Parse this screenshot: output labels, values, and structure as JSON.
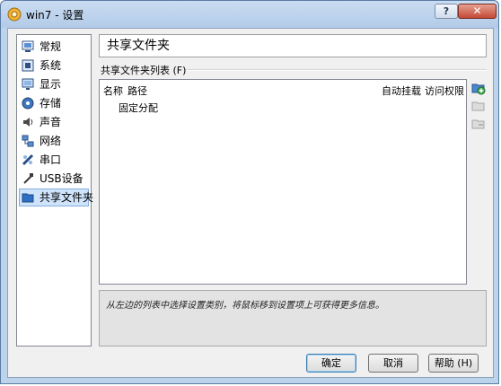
{
  "window": {
    "title": "win7 - 设置",
    "help_glyph": "?",
    "close_glyph": "✕"
  },
  "sidebar": {
    "items": [
      {
        "label": "常规",
        "icon": "general-icon"
      },
      {
        "label": "系统",
        "icon": "system-icon"
      },
      {
        "label": "显示",
        "icon": "display-icon"
      },
      {
        "label": "存储",
        "icon": "storage-icon"
      },
      {
        "label": "声音",
        "icon": "audio-icon"
      },
      {
        "label": "网络",
        "icon": "network-icon"
      },
      {
        "label": "串口",
        "icon": "serial-port-icon"
      },
      {
        "label": "USB设备",
        "icon": "usb-icon"
      },
      {
        "label": "共享文件夹",
        "icon": "shared-folder-icon",
        "selected": true
      }
    ]
  },
  "main": {
    "page_title": "共享文件夹",
    "group_label": "共享文件夹列表 (F)",
    "columns": {
      "name": "名称",
      "path": "路径",
      "auto_mount": "自动挂载",
      "access": "访问权限"
    },
    "rows": [
      {
        "label": "固定分配"
      }
    ],
    "info_text": "从左边的列表中选择设置类别，将鼠标移到设置项上可获得更多信息。"
  },
  "buttons": {
    "ok": "确定",
    "cancel": "取消",
    "help": "帮助 (H)"
  }
}
